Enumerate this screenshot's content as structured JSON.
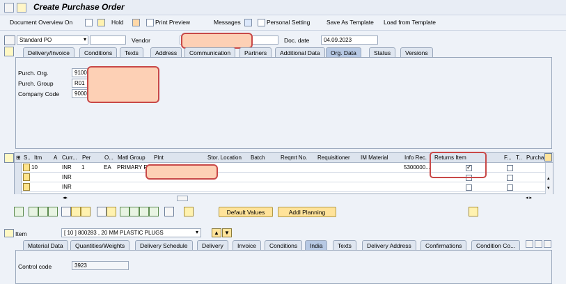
{
  "window": {
    "title": "Create Purchase Order"
  },
  "toolbar": {
    "document_overview": "Document Overview On",
    "hold": "Hold",
    "print_preview": "Print Preview",
    "messages": "Messages",
    "personal_setting": "Personal Setting",
    "save_as_template": "Save As Template",
    "load_from_template": "Load from Template"
  },
  "header": {
    "doc_type": "Standard PO",
    "vendor_label": "Vendor",
    "doc_date_label": "Doc. date",
    "doc_date": "04.09.2023",
    "tabs": [
      "Delivery/Invoice",
      "Conditions",
      "Texts",
      "Address",
      "Communication",
      "Partners",
      "Additional Data",
      "Org. Data",
      "Status",
      "Versions"
    ],
    "active_tab": "Org. Data",
    "org": {
      "purch_org_label": "Purch. Org.",
      "purch_org": "9100",
      "purch_group_label": "Purch. Group",
      "purch_group": "R01",
      "company_code_label": "Company Code",
      "company_code": "9000"
    }
  },
  "items": {
    "columns": [
      "S..",
      "Itm",
      "A",
      "Curr...",
      "Per",
      "O...",
      "Matl Group",
      "Plnt",
      "Stor. Location",
      "Batch",
      "Reqmt No.",
      "Requisitioner",
      "IM Material",
      "Info Rec.",
      "Returns Item",
      "F...",
      "T..",
      "Purcha..."
    ],
    "rows": [
      {
        "itm": "10",
        "curr": "INR",
        "per": "1",
        "o": "EA",
        "matl_group": "PRIMARY P",
        "info_rec": "5300000...",
        "returns": true
      },
      {
        "itm": "",
        "curr": "INR",
        "per": "",
        "o": "",
        "matl_group": "",
        "info_rec": "",
        "returns": false
      },
      {
        "itm": "",
        "curr": "INR",
        "per": "",
        "o": "",
        "matl_group": "",
        "info_rec": "",
        "returns": false
      }
    ],
    "default_values": "Default Values",
    "addl_planning": "Addl Planning"
  },
  "item_detail": {
    "item_label": "Item",
    "item_value": "[ 10 ] 800283 , 20 MM PLASTIC PLUGS",
    "tabs": [
      "Material Data",
      "Quantities/Weights",
      "Delivery Schedule",
      "Delivery",
      "Invoice",
      "Conditions",
      "India",
      "Texts",
      "Delivery Address",
      "Confirmations",
      "Condition Co..."
    ],
    "active_tab": "India",
    "control_code_label": "Control code",
    "control_code": "3923"
  }
}
